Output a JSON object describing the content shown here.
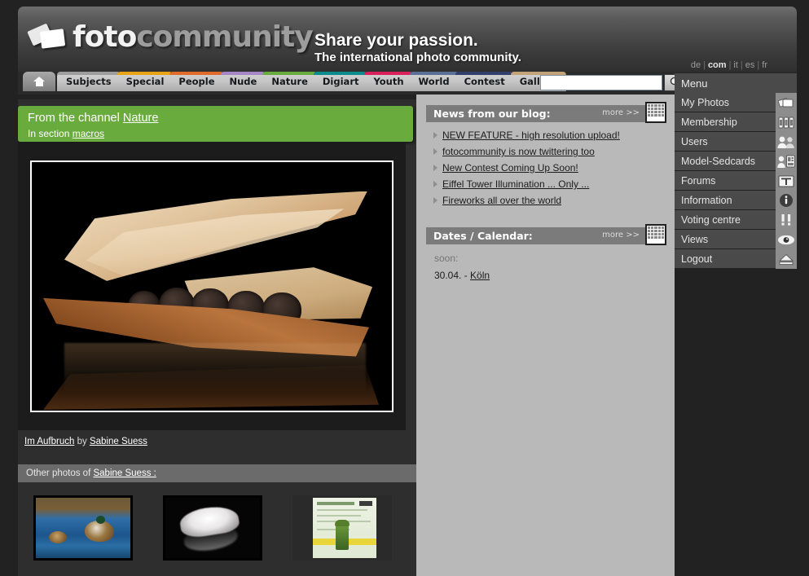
{
  "site": {
    "logo_foto": "foto",
    "logo_community": "community",
    "logo_icon": "photo-cards-icon",
    "slogan_line1": "Share your passion.",
    "slogan_line2": "The international photo community."
  },
  "languages": {
    "items": [
      {
        "label": "de",
        "active": false
      },
      {
        "label": "com",
        "active": true
      },
      {
        "label": "it",
        "active": false
      },
      {
        "label": "es",
        "active": false
      },
      {
        "label": "fr",
        "active": false
      }
    ],
    "separator": "|"
  },
  "tabs": [
    {
      "label": "",
      "name": "home",
      "color": "",
      "icon": "home-icon"
    },
    {
      "label": "Subjects",
      "name": "subjects",
      "color": "#9e9e9e"
    },
    {
      "label": "Special",
      "name": "special",
      "color": "#e8a317"
    },
    {
      "label": "People",
      "name": "people",
      "color": "#e06b2a"
    },
    {
      "label": "Nude",
      "name": "nude",
      "color": "#a487c4"
    },
    {
      "label": "Nature",
      "name": "nature",
      "color": "#6aab3e"
    },
    {
      "label": "Digiart",
      "name": "digiart",
      "color": "#0a8c8c"
    },
    {
      "label": "Youth",
      "name": "youth",
      "color": "#d8215c"
    },
    {
      "label": "World",
      "name": "world",
      "color": "#5a6e96"
    },
    {
      "label": "Contest",
      "name": "contest",
      "color": "#333f6b"
    },
    {
      "label": "Gallery",
      "name": "gallery",
      "color": "#c4a579"
    }
  ],
  "search": {
    "value": "",
    "placeholder": "",
    "button_icon": "magnifier-icon"
  },
  "channel": {
    "prefix": "From the channel",
    "channel_name": "Nature",
    "section_prefix": "In section",
    "section_name": "macros",
    "background_color": "#6aab3e"
  },
  "photo": {
    "title": "Im Aufbruch",
    "by_word": "by",
    "author": "Sabine Suess",
    "description": "macro photograph of an opened seed pod with dark seeds and its reflection on a black background"
  },
  "other_photos": {
    "prefix": "Other photos of",
    "author_link": "Sabine Suess :",
    "thumbnails": [
      {
        "name": "thumbnail-ducks",
        "description": "two ducks splashing on blue water"
      },
      {
        "name": "thumbnail-feather",
        "description": "white feather on black reflective surface"
      },
      {
        "name": "thumbnail-form",
        "description": "green tax form document with a green toy soldier"
      }
    ]
  },
  "news": {
    "title": "News from our blog:",
    "more_label": "more >>",
    "more_icon": "calendar-icon",
    "items": [
      "NEW FEATURE - high resolution upload!",
      "fotocommunity is now twittering too",
      "New Contest Coming Up Soon!",
      "Eiffel Tower Illumination ... Only ...",
      "Fireworks all over the world"
    ]
  },
  "dates": {
    "title": "Dates / Calendar:",
    "more_label": "more >>",
    "more_icon": "calendar-icon",
    "soon_label": "soon:",
    "entries": [
      {
        "date": "30.04. -",
        "place": "Köln"
      }
    ]
  },
  "menu": {
    "title": "Menu",
    "items": [
      {
        "label": "My Photos",
        "icon": "photos-stack-icon"
      },
      {
        "label": "Membership",
        "icon": "cards-icon"
      },
      {
        "label": "Users",
        "icon": "people-icon"
      },
      {
        "label": "Model-Sedcards",
        "icon": "sedcard-icon"
      },
      {
        "label": "Forums",
        "icon": "text-t-icon"
      },
      {
        "label": "Information",
        "icon": "info-circle-icon"
      },
      {
        "label": "Voting centre",
        "icon": "exclamation-pair-icon"
      },
      {
        "label": "Views",
        "icon": "eye-icon"
      },
      {
        "label": "Logout",
        "icon": "eject-icon"
      }
    ]
  },
  "colors": {
    "page_background": "#222222",
    "header_dark": "#3e3e3e",
    "panel_head": "#7b7b7b",
    "mid_column": "#b9b9b9",
    "menu_item": "#4a4a4a",
    "accent_green": "#6aab3e"
  }
}
